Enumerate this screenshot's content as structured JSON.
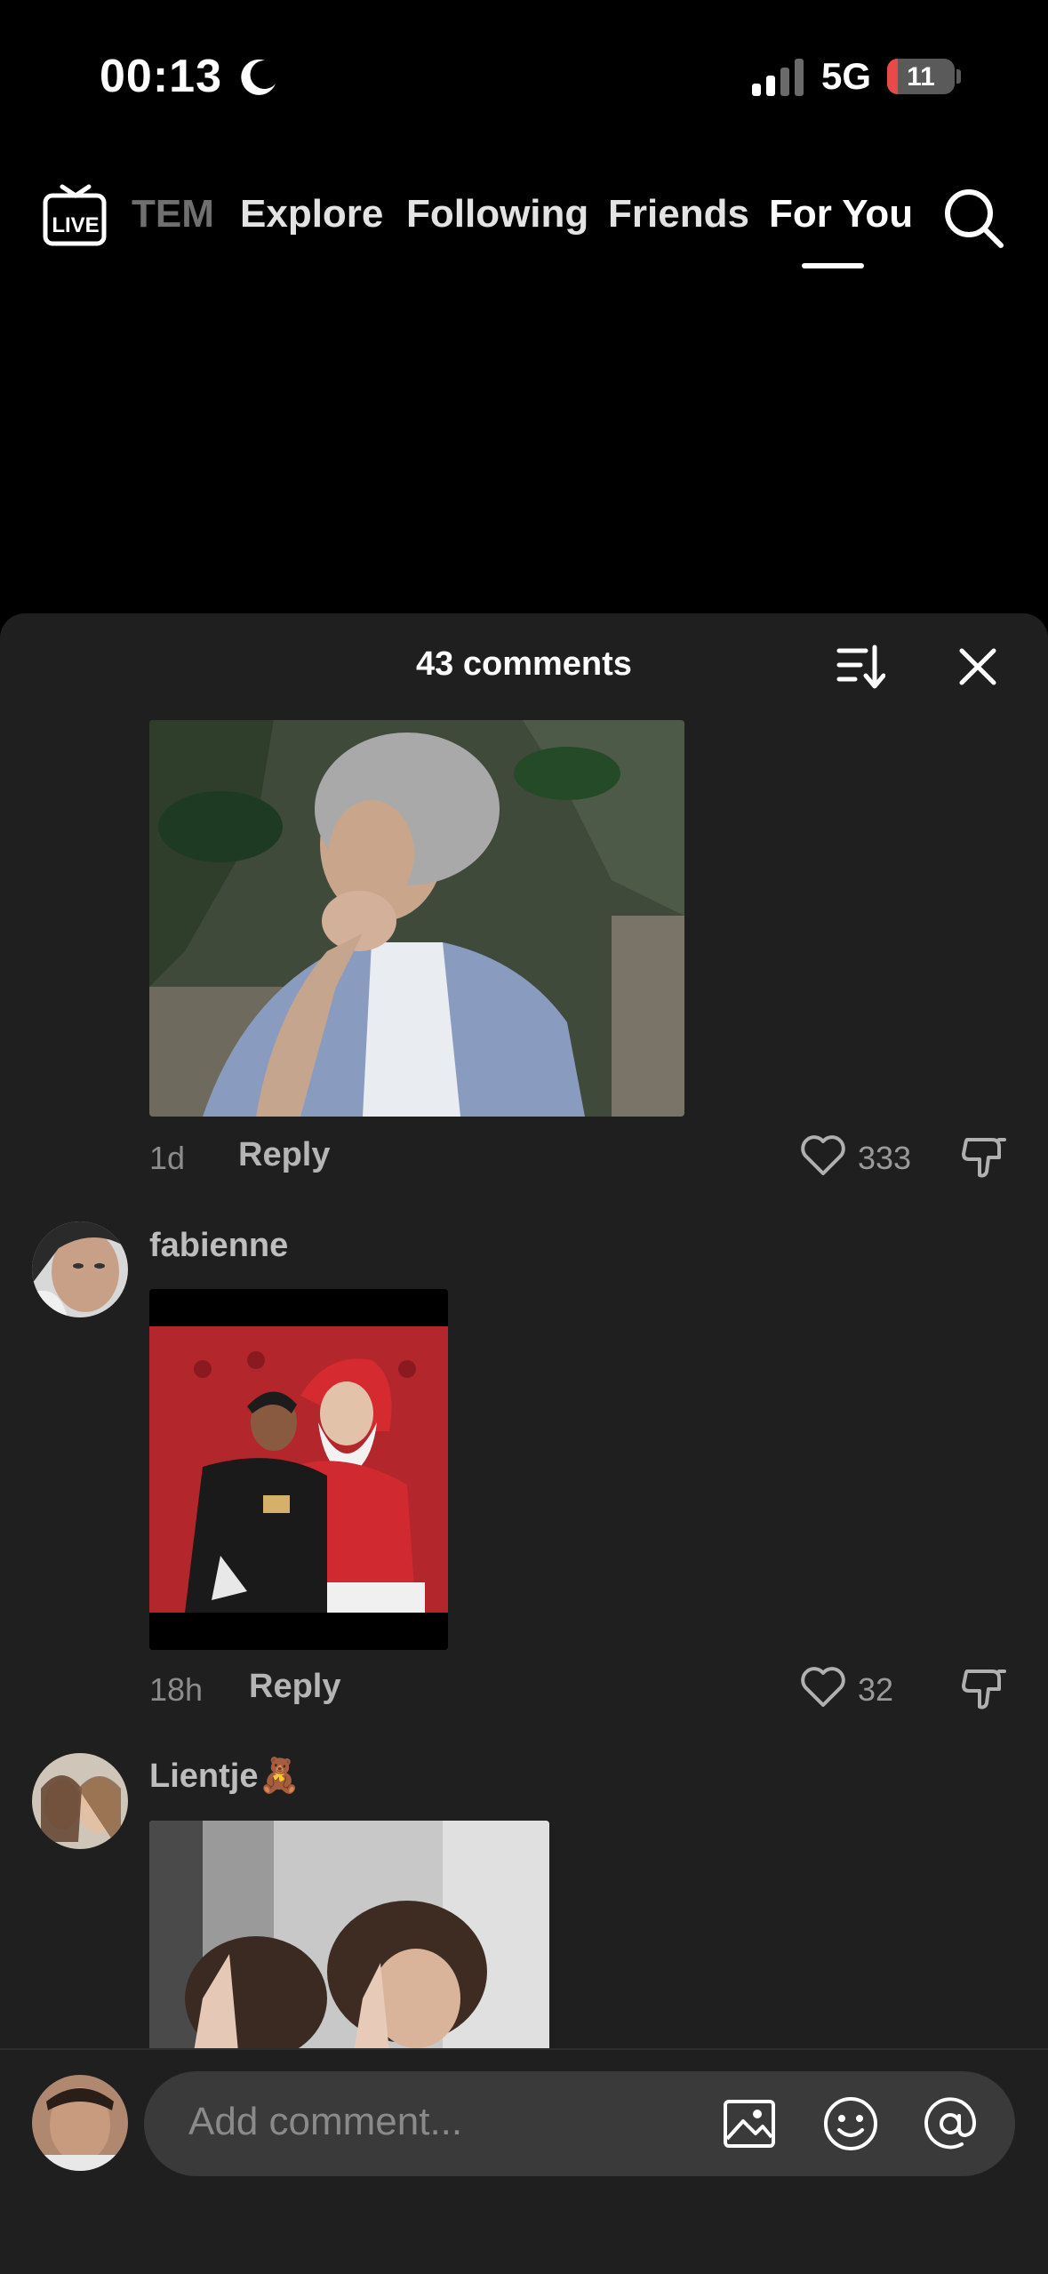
{
  "status_bar": {
    "time": "00:13",
    "network": "5G",
    "battery": "11"
  },
  "nav": {
    "tabs": [
      {
        "label": "TEM"
      },
      {
        "label": "Explore"
      },
      {
        "label": "Following"
      },
      {
        "label": "Friends"
      },
      {
        "label": "For You"
      }
    ],
    "active_tab": "For You"
  },
  "comments_sheet": {
    "title": "43 comments",
    "comments": [
      {
        "username": "",
        "time": "1d",
        "reply_label": "Reply",
        "likes": "333"
      },
      {
        "username": "fabienne",
        "time": "18h",
        "reply_label": "Reply",
        "likes": "32"
      },
      {
        "username": "Lientje🧸",
        "time": "",
        "reply_label": "",
        "likes": ""
      }
    ]
  },
  "composer": {
    "placeholder": "Add comment..."
  },
  "colors": {
    "background": "#000000",
    "sheet": "#1f1f1f",
    "input": "#3a3a3a",
    "battery_low": "#e84a4a"
  }
}
